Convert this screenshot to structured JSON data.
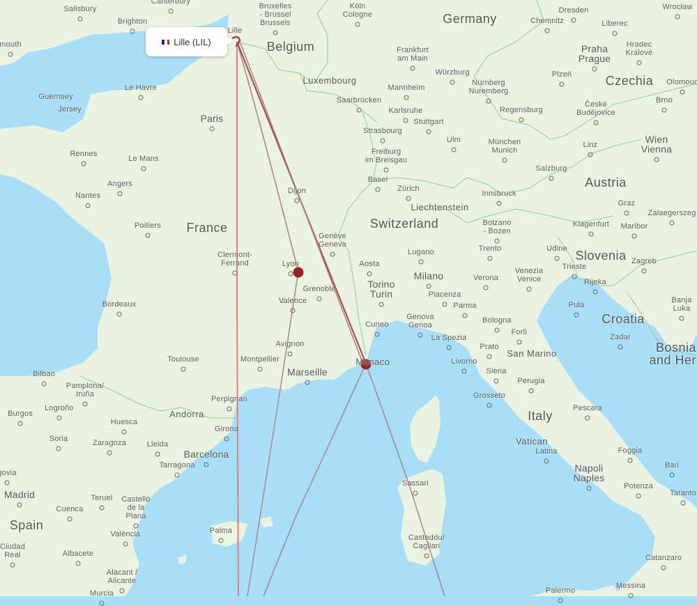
{
  "popup": {
    "flag": "France",
    "label": "Lille (LIL)",
    "flag_colors": [
      "#0c2a7a",
      "#ffffff",
      "#e0222e"
    ]
  },
  "colors": {
    "water": "#a9def9",
    "land": "#eaf3e1",
    "route_primary": "#e87b7b",
    "route_secondary": "#b07a7a",
    "route_dark": "#a04848",
    "airport_marker": "#9b2226",
    "border": "#8fce8a"
  },
  "origin": {
    "name": "Lille",
    "code": "LIL"
  },
  "airports": [
    {
      "name": "Lyon",
      "type": "stopover-marker"
    },
    {
      "name": "Monaco/Nice",
      "type": "stopover-marker"
    }
  ],
  "routes": [
    {
      "from": "Lille",
      "to": "off-map south (via Palma)",
      "style": "primary"
    },
    {
      "from": "Lille",
      "to": "Lyon",
      "style": "secondary"
    },
    {
      "from": "Lille",
      "to": "Monaco",
      "style": "dark"
    },
    {
      "from": "Lyon",
      "to": "off-map south",
      "style": "secondary"
    },
    {
      "from": "Monaco",
      "to": "off-map south-west",
      "style": "secondary"
    },
    {
      "from": "Monaco",
      "to": "off-map south (via Sardinia)",
      "style": "secondary"
    }
  ],
  "countries": [
    {
      "name": "Germany"
    },
    {
      "name": "Belgium"
    },
    {
      "name": "Luxembourg"
    },
    {
      "name": "France"
    },
    {
      "name": "Switzerland"
    },
    {
      "name": "Liechtenstein"
    },
    {
      "name": "Austria"
    },
    {
      "name": "Czechia"
    },
    {
      "name": "Slovenia"
    },
    {
      "name": "Croatia"
    },
    {
      "name": "Bosnia and Herz"
    },
    {
      "name": "Italy"
    },
    {
      "name": "San Marino"
    },
    {
      "name": "Vatican"
    },
    {
      "name": "Monaco"
    },
    {
      "name": "Andorra"
    },
    {
      "name": "Spain"
    }
  ],
  "cities": [
    {
      "name": "Salisbury"
    },
    {
      "name": "Brighton"
    },
    {
      "name": "Canterbury"
    },
    {
      "name": "Plymouth"
    },
    {
      "name": "Guernsey"
    },
    {
      "name": "Jersey"
    },
    {
      "name": "Le Havre"
    },
    {
      "name": "Paris"
    },
    {
      "name": "Lille"
    },
    {
      "name": "Bruxelles - Brussel Brussels"
    },
    {
      "name": "Köln Cologne"
    },
    {
      "name": "Frankfurt am Main"
    },
    {
      "name": "Würzburg"
    },
    {
      "name": "Mannheim"
    },
    {
      "name": "Saarbrücken"
    },
    {
      "name": "Karlsruhe"
    },
    {
      "name": "Stuttgart"
    },
    {
      "name": "Strasbourg"
    },
    {
      "name": "Freiburg im Breisgau"
    },
    {
      "name": "Basel"
    },
    {
      "name": "Zürich"
    },
    {
      "name": "Ulm"
    },
    {
      "name": "München Munich"
    },
    {
      "name": "Salzburg"
    },
    {
      "name": "Innsbruck"
    },
    {
      "name": "Bolzano - Bozen"
    },
    {
      "name": "Dresden"
    },
    {
      "name": "Chemnitz"
    },
    {
      "name": "Liberec"
    },
    {
      "name": "Praha Prague"
    },
    {
      "name": "Hradec Králové"
    },
    {
      "name": "Plzeň"
    },
    {
      "name": "Nürnberg Nuremberg"
    },
    {
      "name": "Regensburg"
    },
    {
      "name": "České Budějovice"
    },
    {
      "name": "Brno"
    },
    {
      "name": "Olomouc"
    },
    {
      "name": "Wrocław"
    },
    {
      "name": "Linz"
    },
    {
      "name": "Wien Vienna"
    },
    {
      "name": "Graz"
    },
    {
      "name": "Zalaegerszeg"
    },
    {
      "name": "Klagenfurt"
    },
    {
      "name": "Maribor"
    },
    {
      "name": "Rennes"
    },
    {
      "name": "Le Mans"
    },
    {
      "name": "Angers"
    },
    {
      "name": "Nantes"
    },
    {
      "name": "Poitiers"
    },
    {
      "name": "Dijon"
    },
    {
      "name": "Genève Geneva"
    },
    {
      "name": "Clermont-Ferrand"
    },
    {
      "name": "Lyon"
    },
    {
      "name": "Grenoble"
    },
    {
      "name": "Valence"
    },
    {
      "name": "Bordeaux"
    },
    {
      "name": "Avignon"
    },
    {
      "name": "Toulouse"
    },
    {
      "name": "Montpellier"
    },
    {
      "name": "Marseille"
    },
    {
      "name": "Perpignan"
    },
    {
      "name": "Aosta"
    },
    {
      "name": "Torino Turin"
    },
    {
      "name": "Cuneo"
    },
    {
      "name": "Lugano"
    },
    {
      "name": "Milano"
    },
    {
      "name": "Piacenza"
    },
    {
      "name": "Parma"
    },
    {
      "name": "Genova Genoa"
    },
    {
      "name": "La Spezia"
    },
    {
      "name": "Livorno"
    },
    {
      "name": "Trento"
    },
    {
      "name": "Verona"
    },
    {
      "name": "Venezia Venice"
    },
    {
      "name": "Udine"
    },
    {
      "name": "Trieste"
    },
    {
      "name": "Rijeka"
    },
    {
      "name": "Pula"
    },
    {
      "name": "Zagreb"
    },
    {
      "name": "Banja Luka"
    },
    {
      "name": "Zadar"
    },
    {
      "name": "Bologna"
    },
    {
      "name": "Forlì"
    },
    {
      "name": "Prato"
    },
    {
      "name": "Siena"
    },
    {
      "name": "Perugia"
    },
    {
      "name": "Grosseto"
    },
    {
      "name": "Pescara"
    },
    {
      "name": "Latina"
    },
    {
      "name": "Foggia"
    },
    {
      "name": "Bari"
    },
    {
      "name": "Napoli Naples"
    },
    {
      "name": "Potenza"
    },
    {
      "name": "Taranto"
    },
    {
      "name": "Catanzaro"
    },
    {
      "name": "Messina"
    },
    {
      "name": "Palermo"
    },
    {
      "name": "Sassari"
    },
    {
      "name": "Casteddu/ Cagliari"
    },
    {
      "name": "Bilbao"
    },
    {
      "name": "Pamplona/ Iruña"
    },
    {
      "name": "Logroño"
    },
    {
      "name": "Burgos"
    },
    {
      "name": "Huesca"
    },
    {
      "name": "Soria"
    },
    {
      "name": "Zaragoza"
    },
    {
      "name": "Lleida"
    },
    {
      "name": "Girona"
    },
    {
      "name": "Barcelona"
    },
    {
      "name": "Tarragona"
    },
    {
      "name": "Segovia"
    },
    {
      "name": "Madrid"
    },
    {
      "name": "Teruel"
    },
    {
      "name": "Castelló de la Plana"
    },
    {
      "name": "Cuenca"
    },
    {
      "name": "València"
    },
    {
      "name": "Palma"
    },
    {
      "name": "Ciudad Real"
    },
    {
      "name": "Albacete"
    },
    {
      "name": "Alacant / Alicante"
    },
    {
      "name": "Murcia"
    }
  ]
}
